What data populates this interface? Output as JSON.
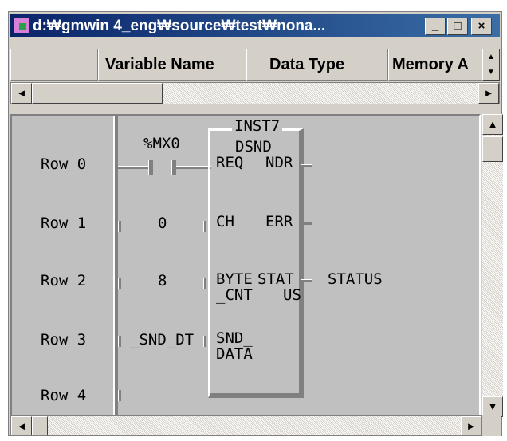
{
  "window": {
    "title": "d:₩gmwin 4_eng₩source₩test₩nona...",
    "controls": {
      "minimize": "_",
      "maximize": "□",
      "close": "×"
    }
  },
  "header": {
    "columns": [
      "",
      "Variable Name",
      "Data Type",
      "Memory A"
    ]
  },
  "scroll": {
    "left": "◄",
    "right": "►",
    "up": "▲",
    "down": "▼",
    "spin_up": "▲",
    "spin_down": "▼"
  },
  "ladder": {
    "rows": [
      "Row 0",
      "Row 1",
      "Row 2",
      "Row 3",
      "Row 4"
    ],
    "contact_label": "%MX0",
    "block": {
      "instance": "INST7",
      "type": "DSND"
    },
    "inputs": [
      "REQ",
      "CH",
      "BYTE",
      "_CNT",
      "SND_",
      "DATA"
    ],
    "outputs": [
      "NDR",
      "ERR",
      "STAT",
      "US"
    ],
    "input_values": [
      "0",
      "8",
      "_SND_DT"
    ],
    "output_values": [
      "STATUS"
    ]
  }
}
